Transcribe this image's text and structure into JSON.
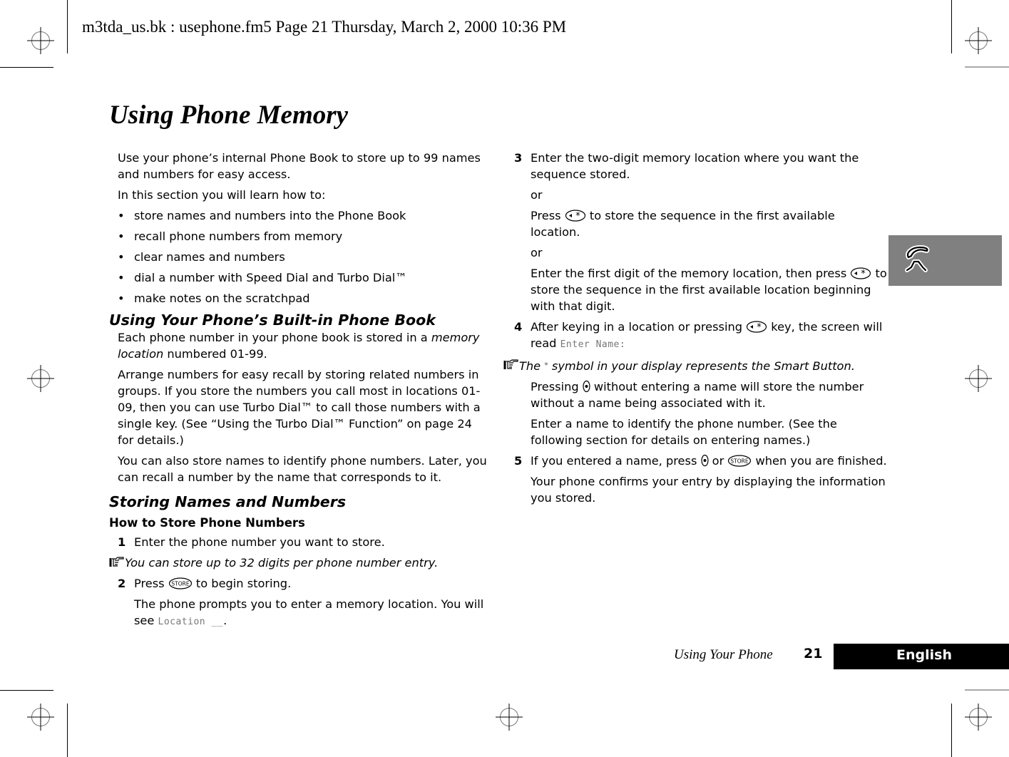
{
  "print_header": "m3tda_us.bk : usephone.fm5  Page 21  Thursday, March 2, 2000  10:36 PM",
  "page_title": "Using Phone Memory",
  "left_column": {
    "intro": "Use your phone’s internal Phone Book to store up to 99 names and numbers for easy access.",
    "learn_intro": "In this section you will learn how to:",
    "bullets": [
      "store names and numbers into the Phone Book",
      "recall phone numbers from memory",
      "clear names and numbers",
      "dial a number with Speed Dial and Turbo Dial™",
      "make notes on the scratchpad"
    ],
    "bullet_glyph": "•",
    "section1": {
      "heading": "Using Your Phone’s Built-in Phone Book",
      "para1_pre": "Each phone number in your phone book is stored in a ",
      "para1_em": "memory location",
      "para1_post": " numbered 01-99.",
      "para2": "Arrange numbers for easy recall by storing related numbers in groups. If you store the numbers you call most in locations 01-09, then you can use Turbo Dial™ to call those numbers with a single key. (See “Using the Turbo Dial™ Function” on page 24 for details.)",
      "para3": "You can also store names to identify phone numbers. Later, you can recall a number by the name that corresponds to it."
    },
    "section2": {
      "heading": "Storing Names and Numbers",
      "subheading": "How to Store Phone Numbers",
      "step1_num": "1",
      "step1": "Enter the phone number you want to store.",
      "note1": "You can store up to 32 digits per phone number entry.",
      "step2_num": "2",
      "step2_pre": "Press ",
      "step2_post": " to begin storing.",
      "step2_detail_pre": "The phone prompts you to enter a memory location. You will see ",
      "step2_lcd": "Location __",
      "step2_detail_post": "."
    }
  },
  "right_column": {
    "step3_num": "3",
    "step3": "Enter the two-digit memory location where you want the sequence stored.",
    "or1": "or",
    "alt1_pre": "Press ",
    "alt1_post": " to store the sequence in the first available location.",
    "or2": "or",
    "alt2_pre": "Enter the first digit of the memory location, then press ",
    "alt2_post": " to store the sequence in the first available location beginning with that digit.",
    "step4_num": "4",
    "step4_pre": "After keying in a location or pressing ",
    "step4_mid": " key, the screen will read ",
    "step4_lcd": "Enter Name:",
    "note2_pre": "The ",
    "note2_symbol": "*",
    "note2_post": " symbol in your display represents the Smart Button.",
    "press_pre": "Pressing ",
    "press_post": " without entering a name will store the number without a name being associated with it.",
    "enter_name": "Enter a name to identify the phone number. (See the following section for details on entering names.)",
    "step5_num": "5",
    "step5_pre": "If you entered a name, press ",
    "step5_or": " or ",
    "step5_post": " when you are finished.",
    "confirm": "Your phone confirms your entry by displaying the information you stored."
  },
  "keys": {
    "store_label": "STORE",
    "star_key": "◂✱",
    "smart_button": "smart-button"
  },
  "side_tab": {
    "icon": "phone-handset-icon",
    "color": "#808080"
  },
  "footer": {
    "section_name": "Using Your Phone",
    "page_number": "21",
    "language": "English"
  }
}
